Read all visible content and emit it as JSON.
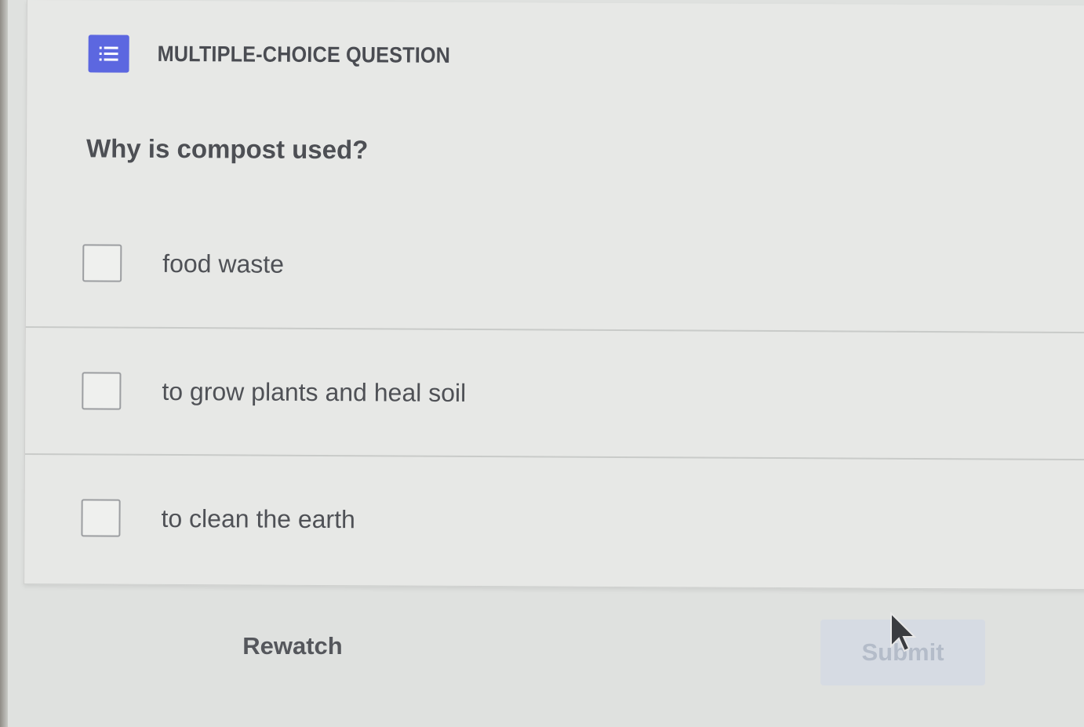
{
  "question_card": {
    "header_label": "MULTIPLE-CHOICE QUESTION",
    "header_icon": "list-icon",
    "accent_color": "#5c67e0",
    "question": "Why is compost used?",
    "options": [
      {
        "label": "food waste",
        "checked": false
      },
      {
        "label": "to grow plants and heal soil",
        "checked": false
      },
      {
        "label": "to clean the earth",
        "checked": false
      }
    ]
  },
  "actions": {
    "rewatch_label": "Rewatch",
    "submit_label": "Submit",
    "submit_state": "disabled"
  },
  "cursor": {
    "icon": "arrow-pointer-icon"
  }
}
